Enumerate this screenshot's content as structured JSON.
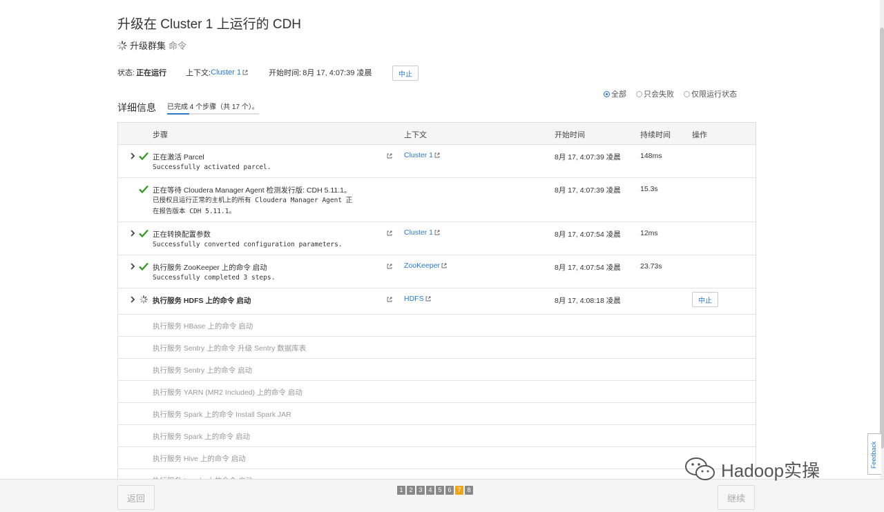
{
  "header": {
    "title": "升级在 Cluster 1 上运行的 CDH",
    "command_name": "升级群集",
    "command_suffix": "命令"
  },
  "status": {
    "status_label": "状态:",
    "status_value": "正在运行",
    "context_label": "上下文:",
    "context_value": "Cluster 1",
    "start_label": "开始时间:",
    "start_value": "8月 17, 4:07:39 凌晨",
    "abort_label": "中止"
  },
  "filters": [
    {
      "label": "全部",
      "selected": true
    },
    {
      "label": "只会失败",
      "selected": false
    },
    {
      "label": "仅限运行状态",
      "selected": false
    }
  ],
  "details": {
    "title": "详细信息",
    "progress": "已完成 4 个步骤（共 17 个）。"
  },
  "table": {
    "headers": {
      "step": "步骤",
      "context": "上下文",
      "start": "开始时间",
      "duration": "持续时间",
      "action": "操作"
    },
    "rows": [
      {
        "title": "正在激活 Parcel",
        "desc": "Successfully activated parcel.",
        "context": "Cluster 1",
        "start": "8月 17, 4:07:39 凌晨",
        "duration": "148ms"
      },
      {
        "title": "正在等待 Cloudera Manager Agent 检测发行版: CDH 5.11.1。",
        "desc": "已授权且运行正常的主机上的所有 Cloudera Manager Agent 正\n在报告版本 CDH 5.11.1。",
        "start": "8月 17, 4:07:39 凌晨",
        "duration": "15.3s"
      },
      {
        "title": "正在转换配置参数",
        "desc": "Successfully converted configuration parameters.",
        "context": "Cluster 1",
        "start": "8月 17, 4:07:54 凌晨",
        "duration": "12ms"
      },
      {
        "title": "执行服务 ZooKeeper 上的命令 启动",
        "desc": "Successfully completed 3 steps.",
        "context": "ZooKeeper",
        "start": "8月 17, 4:07:54 凌晨",
        "duration": "23.73s"
      },
      {
        "title": "执行服务 HDFS 上的命令 启动",
        "context": "HDFS",
        "start": "8月 17, 4:08:18 凌晨",
        "action": "中止"
      }
    ],
    "pending": [
      "执行服务 HBase 上的命令 启动",
      "执行服务 Sentry 上的命令 升级 Sentry 数据库表",
      "执行服务 Sentry 上的命令 启动",
      "执行服务 YARN (MR2 Included) 上的命令 启动",
      "执行服务 Spark 上的命令 Install Spark JAR",
      "执行服务 Spark 上的命令 启动",
      "执行服务 Hive 上的命令 启动",
      "执行服务 Impala 上的命令 启动"
    ]
  },
  "footer": {
    "back": "返回",
    "next": "继续",
    "pages": [
      "1",
      "2",
      "3",
      "4",
      "5",
      "6",
      "7",
      "8"
    ],
    "active_page": "7"
  },
  "feedback": "Feedback",
  "watermark": "Hadoop实操",
  "colors": {
    "link": "#2b78c5",
    "success": "#3a9a2a",
    "active_page": "#f0a31c"
  }
}
